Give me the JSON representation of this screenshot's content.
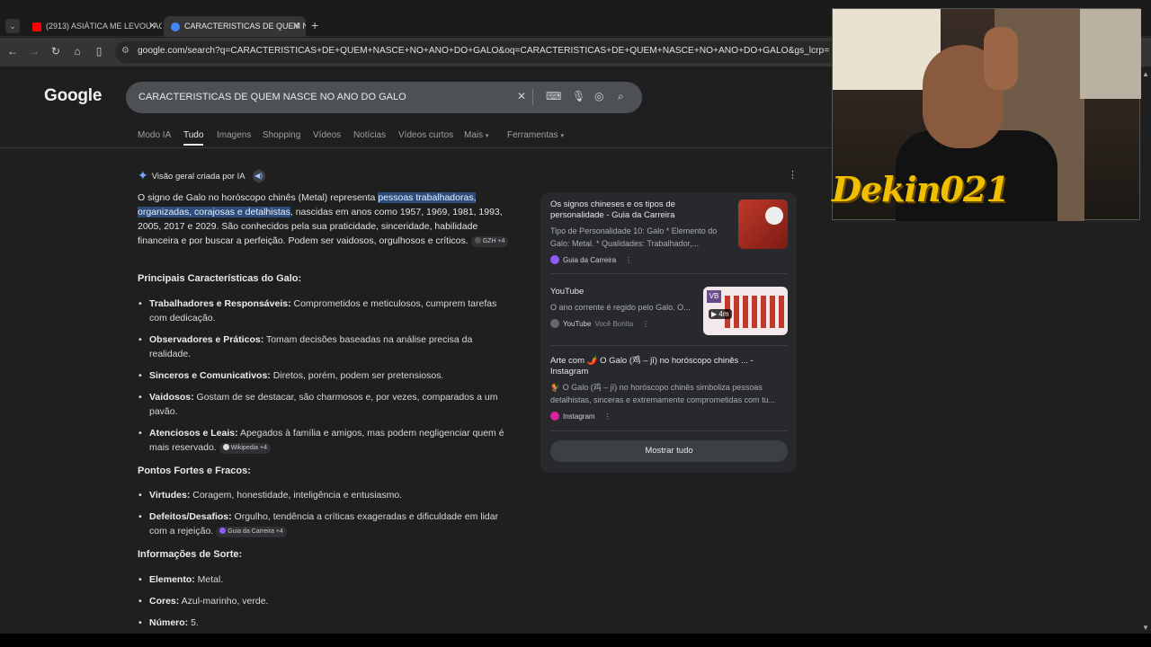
{
  "browser": {
    "tabs": [
      {
        "title": "(2913) ASIÁTICA ME LEVOU AO",
        "favicon": "youtube-icon",
        "color": "#ff0000"
      },
      {
        "title": "CARACTERISTICAS DE QUEM N",
        "favicon": "google-icon",
        "color": "#4285f4"
      }
    ],
    "url": "google.com/search?q=CARACTERISTICAS+DE+QUEM+NASCE+NO+ANO+DO+GALO&oq=CARACTERISTICAS+DE+QUEM+NASCE+NO+ANO+DO+GALO&gs_lcrp=EgZjaHJvbWUyBggAEE"
  },
  "google": {
    "logo": "Google",
    "query": "CARACTERISTICAS DE QUEM NASCE NO ANO DO GALO",
    "tabs": [
      "Modo IA",
      "Tudo",
      "Imagens",
      "Shopping",
      "Vídeos",
      "Notícias",
      "Vídeos curtos",
      "Mais",
      "Ferramentas"
    ],
    "active_tab": "Tudo"
  },
  "ai": {
    "header": "Visão geral criada por IA",
    "p1_a": "O signo de Galo no horóscopo chinês (Metal) representa ",
    "p1_hl1": "pessoas trabalhadoras,",
    "p1_hl2": "organizadas, corajosas e detalhistas",
    "p1_b": ", nascidas em anos como 1957, 1969, 1981, 1993, 2005, 2017 e 2029. São conhecidos pela sua praticidade, sinceridade, habilidade financeira e por buscar a perfeição. Podem ser vaidosos, orgulhosos e críticos.",
    "p1_chip": "GZH +4",
    "h1": "Principais Características do Galo:",
    "items1": [
      {
        "b": "Trabalhadores e Responsáveis:",
        "t": " Comprometidos e meticulosos, cumprem tarefas com dedicação."
      },
      {
        "b": "Observadores e Práticos:",
        "t": " Tomam decisões baseadas na análise precisa da realidade."
      },
      {
        "b": "Sinceros e Comunicativos:",
        "t": " Diretos, porém, podem ser pretensiosos."
      },
      {
        "b": "Vaidosos:",
        "t": " Gostam de se destacar, são charmosos e, por vezes, comparados a um pavão."
      },
      {
        "b": "Atenciosos e Leais:",
        "t": " Apegados à família e amigos, mas podem negligenciar quem é mais reservado."
      }
    ],
    "chip_wiki": "Wikipedia +4",
    "h2": "Pontos Fortes e Fracos:",
    "items2": [
      {
        "b": "Virtudes:",
        "t": " Coragem, honestidade, inteligência e entusiasmo."
      },
      {
        "b": "Defeitos/Desafios:",
        "t": " Orgulho, tendência a críticas exageradas e dificuldade em lidar com a rejeição."
      }
    ],
    "chip_guia": "Guia da Carreira +4",
    "h3": "Informações de Sorte:",
    "items3": [
      {
        "b": "Elemento:",
        "t": " Metal."
      },
      {
        "b": "Cores:",
        "t": " Azul-marinho, verde."
      },
      {
        "b": "Número:",
        "t": " 5."
      }
    ]
  },
  "sources": [
    {
      "title": "Os signos chineses e os tipos de personalidade - Guia da Carreira",
      "snippet": "Tipo de Personalidade 10: Galo * Elemento do Galo: Metal. * Qualidades: Trabalhador,...",
      "site": "Guia da Carreira",
      "sub": ""
    },
    {
      "title": "YouTube",
      "snippet": "O ano corrente é regido pelo Galo. O...",
      "site": "YouTube",
      "sub": "Você Bonita",
      "duration": "4m",
      "thumb_text": "VB"
    },
    {
      "title": "Arte com 🌶️ O Galo (鸡 – jī) no horóscopo chinês ... - Instagram",
      "snippet": "🐓 O Galo (鸡 – jī) no horóscopo chinês simboliza pessoas detalhistas, sinceras e extremamente comprometidas com tu...",
      "site": "Instagram",
      "sub": ""
    }
  ],
  "show_all": "Mostrar tudo",
  "webcam": {
    "overlay_name": "Dekin021"
  }
}
